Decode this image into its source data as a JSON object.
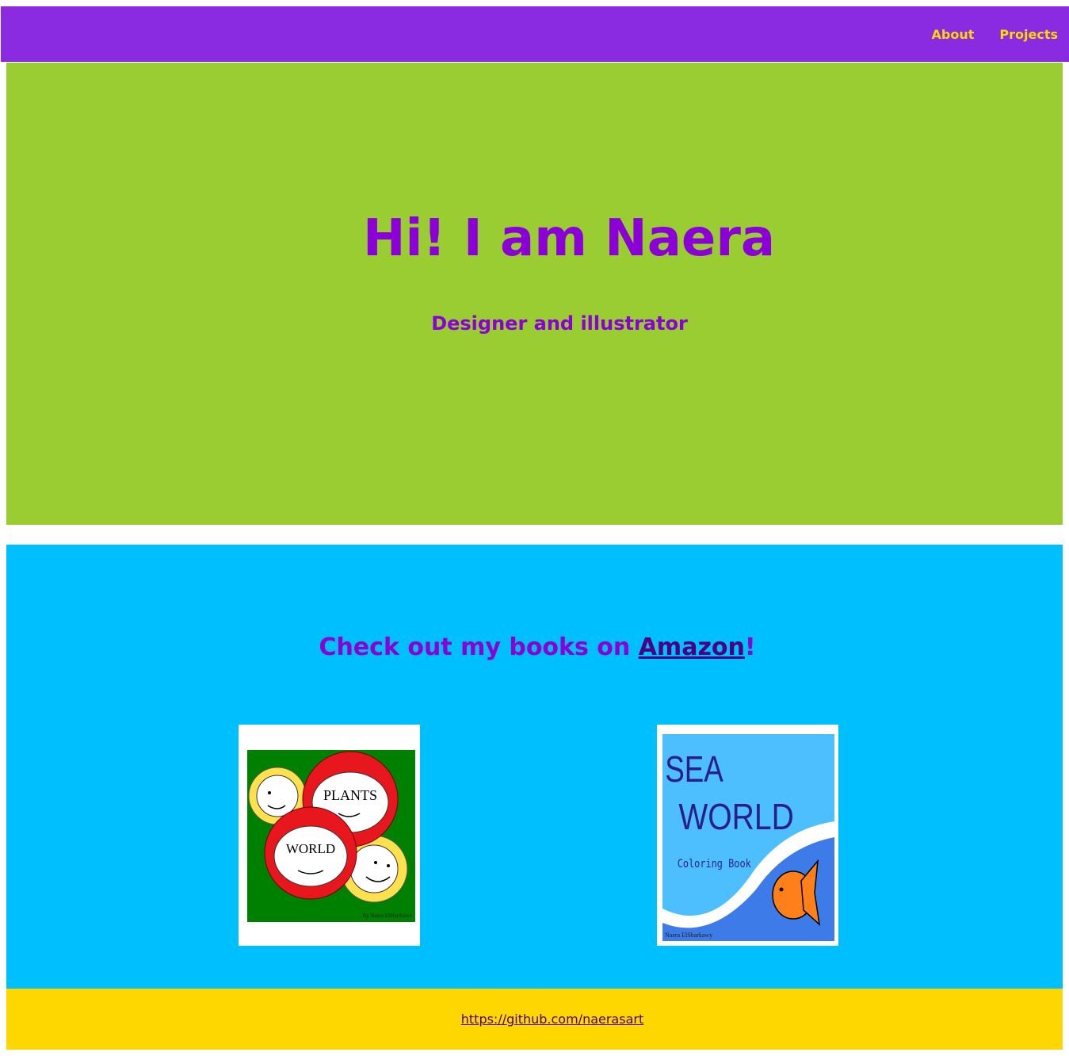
{
  "nav": {
    "items": [
      {
        "label": "About"
      },
      {
        "label": "Projects"
      }
    ]
  },
  "hero": {
    "title": "Hi! I am Naera",
    "subtitle": "Designer and illustrator"
  },
  "books": {
    "heading_prefix": "Check out my books on ",
    "amazon_label": "Amazon",
    "heading_suffix": "!",
    "items": [
      {
        "line1": "PLANTS",
        "line2": "WORLD",
        "author": "By Naera ElSharkawy",
        "icon": "plants-world-cover-icon"
      },
      {
        "line1": "SEA",
        "line2": "WORLD",
        "line3": "Coloring Book",
        "author": "Naera ElSharkawy",
        "icon": "sea-world-cover-icon"
      }
    ]
  },
  "footer": {
    "link": "https://github.com/naerasart"
  },
  "colors": {
    "navbar": "#8a2be2",
    "nav_text": "#ffd700",
    "hero_bg": "#9acd32",
    "accent_purple": "#8b00d6",
    "books_bg": "#00bfff",
    "footer_bg": "#ffd700",
    "link": "#4b0082"
  }
}
